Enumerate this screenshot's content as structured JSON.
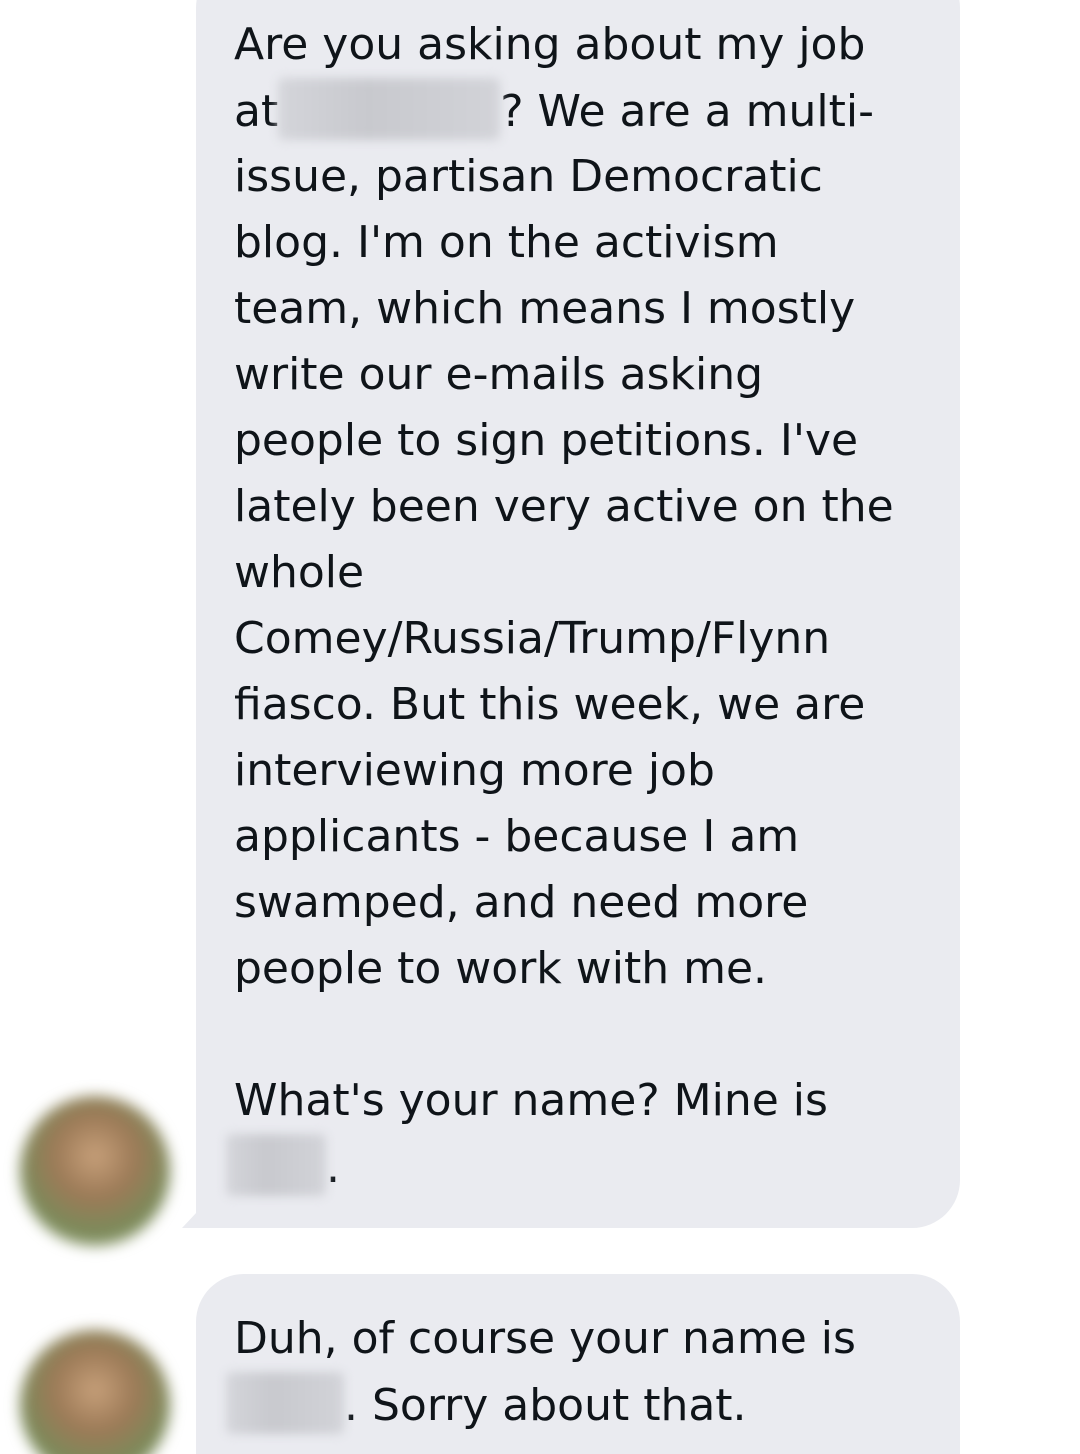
{
  "messages": [
    {
      "sender": "other",
      "lines": {
        "l1": "Are you asking about my job",
        "l2_pre": "at",
        "l2_post": "? We are a multi-",
        "l3": "issue, partisan Democratic",
        "l4": "blog. I'm on the activism",
        "l5": "team, which means I mostly",
        "l6": "write our e-mails asking",
        "l7": "people to sign petitions. I've",
        "l8": "lately been very active on the",
        "l9": "whole",
        "l10": "Comey/Russia/Trump/Flynn",
        "l11": "fiasco. But this week, we are",
        "l12": "interviewing more job",
        "l13": "applicants - because I am",
        "l14": "swamped, and need more",
        "l15": "people to work with me.",
        "l16": "What's your name? Mine is",
        "l17_post": "."
      }
    },
    {
      "sender": "other",
      "lines": {
        "l1": "Duh, of course your name is",
        "l2_post": ". Sorry about that."
      }
    }
  ]
}
